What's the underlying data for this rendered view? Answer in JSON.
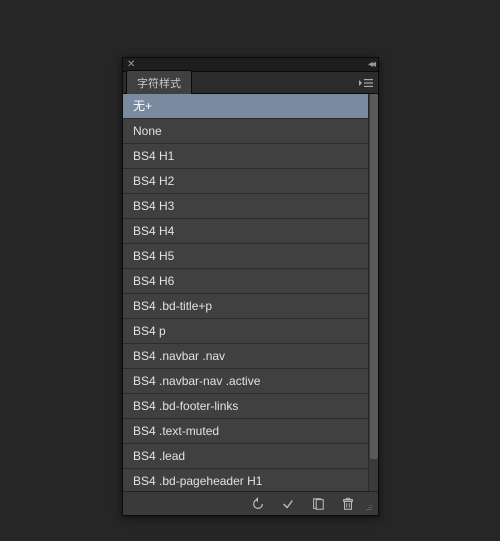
{
  "panel": {
    "tab_label": "字符样式",
    "styles": [
      {
        "label": "无+",
        "selected": true
      },
      {
        "label": "None",
        "selected": false
      },
      {
        "label": "BS4 H1",
        "selected": false
      },
      {
        "label": "BS4 H2",
        "selected": false
      },
      {
        "label": "BS4 H3",
        "selected": false
      },
      {
        "label": "BS4 H4",
        "selected": false
      },
      {
        "label": "BS4 H5",
        "selected": false
      },
      {
        "label": "BS4 H6",
        "selected": false
      },
      {
        "label": "BS4 .bd-title+p",
        "selected": false
      },
      {
        "label": "BS4 p",
        "selected": false
      },
      {
        "label": "BS4 .navbar .nav",
        "selected": false
      },
      {
        "label": "BS4 .navbar-nav .active",
        "selected": false
      },
      {
        "label": "BS4 .bd-footer-links",
        "selected": false
      },
      {
        "label": "BS4 .text-muted",
        "selected": false
      },
      {
        "label": "BS4 .lead",
        "selected": false
      },
      {
        "label": "BS4 .bd-pageheader H1",
        "selected": false
      }
    ]
  }
}
